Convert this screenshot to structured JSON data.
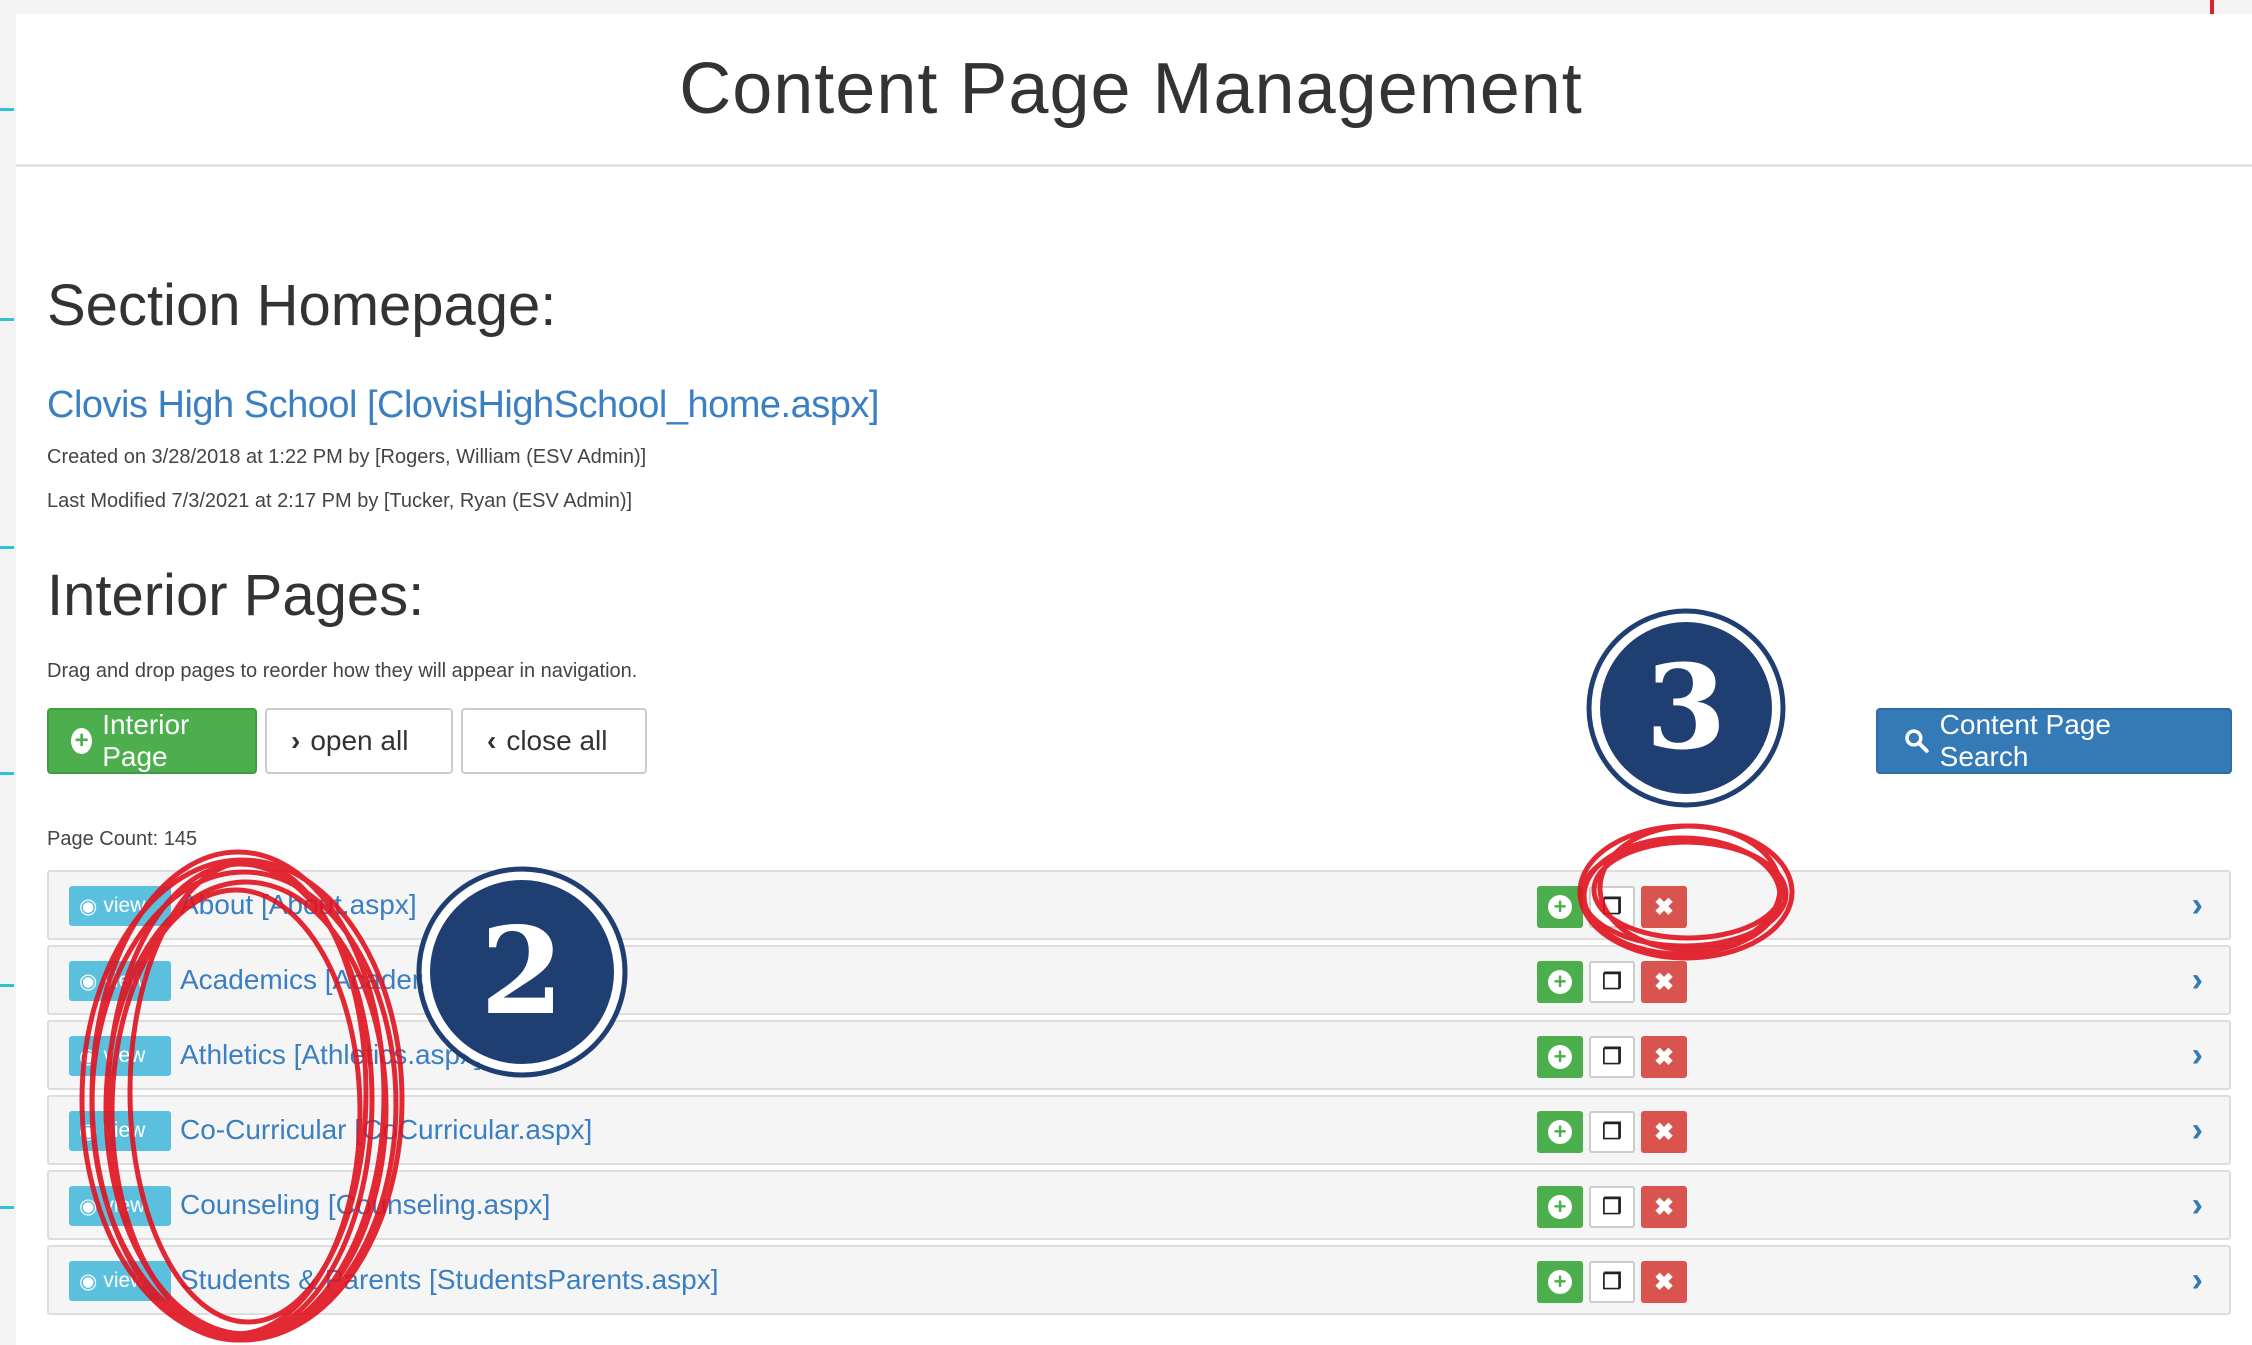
{
  "header": {
    "title": "Content Page Management"
  },
  "section": {
    "title": "Section Homepage:",
    "home_link": "Clovis High School [ClovisHighSchool_home.aspx]",
    "created": "Created on 3/28/2018 at 1:22 PM by [Rogers, William (ESV Admin)]",
    "modified": "Last Modified 7/3/2021 at 2:17 PM by [Tucker, Ryan (ESV Admin)]"
  },
  "interior": {
    "title": "Interior Pages:",
    "hint": "Drag and drop pages to reorder how they will appear in navigation.",
    "add_label": "Interior Page",
    "open_label": "open all",
    "close_label": "close all",
    "search_label": "Content Page Search",
    "page_count": "Page Count: 145"
  },
  "rows": [
    {
      "view": "view",
      "title": "About [About.aspx]"
    },
    {
      "view": "view",
      "title": "Academics [Academics.aspx]"
    },
    {
      "view": "view",
      "title": "Athletics [Athletics.aspx]"
    },
    {
      "view": "view",
      "title": "Co-Curricular [CoCurricular.aspx]"
    },
    {
      "view": "view",
      "title": "Counseling [Counseling.aspx]"
    },
    {
      "view": "view",
      "title": "Students & Parents [StudentsParents.aspx]"
    }
  ],
  "icons": {
    "add": "plus-circle-icon",
    "open": "chevron-right-icon",
    "close": "chevron-left-icon",
    "search": "search-icon",
    "view": "eye-icon",
    "copy": "copy-icon",
    "delete": "close-icon",
    "expand": "chevron-right-icon"
  },
  "annotations": {
    "badge_2": "2",
    "badge_3": "3",
    "marker_color": "#e0121f",
    "badge_color": "#1f3f73"
  },
  "colors": {
    "link": "#3a7fc1",
    "success": "#4cae4c",
    "primary": "#337ab7",
    "danger": "#d9534f",
    "info": "#5bc0de"
  }
}
